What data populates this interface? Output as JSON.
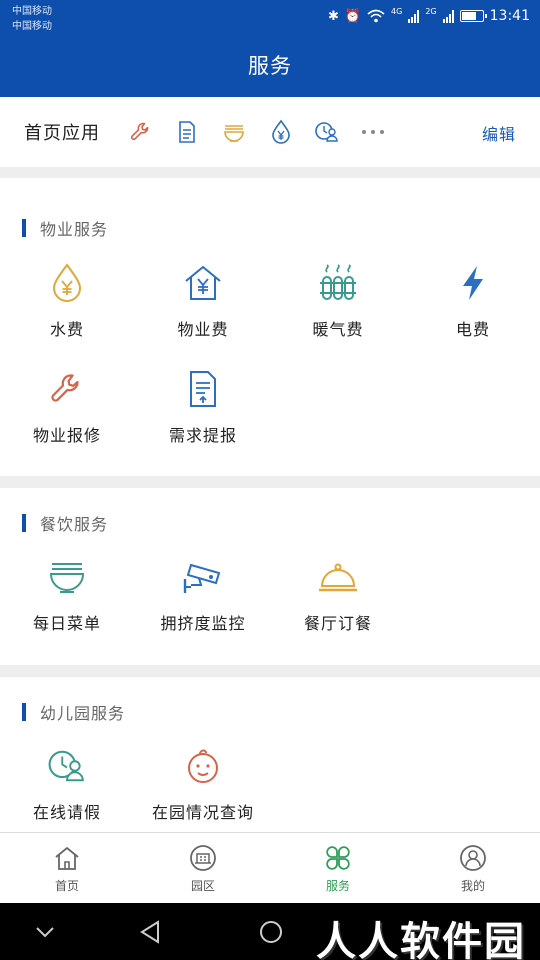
{
  "status_bar": {
    "carrier_1": "中国移动",
    "carrier_2": "中国移动",
    "net_1": "4G",
    "net_2": "2G",
    "time": "13:41"
  },
  "header": {
    "title": "服务"
  },
  "quick_apps": {
    "label": "首页应用",
    "edit_label": "编辑",
    "icons": [
      "wrench-icon",
      "document-icon",
      "noodle-bowl-icon",
      "water-drop-yen-icon",
      "clock-person-icon",
      "more-dots-icon"
    ]
  },
  "sections": {
    "property": {
      "title": "物业服务",
      "items": [
        {
          "label": "水费",
          "icon": "water-drop-yen-icon"
        },
        {
          "label": "物业费",
          "icon": "house-yen-icon"
        },
        {
          "label": "暖气费",
          "icon": "radiator-icon"
        },
        {
          "label": "电费",
          "icon": "lightning-icon"
        },
        {
          "label": "物业报修",
          "icon": "wrench-icon"
        },
        {
          "label": "需求提报",
          "icon": "document-upload-icon"
        }
      ]
    },
    "dining": {
      "title": "餐饮服务",
      "items": [
        {
          "label": "每日菜单",
          "icon": "noodle-bowl-icon"
        },
        {
          "label": "拥挤度监控",
          "icon": "security-camera-icon"
        },
        {
          "label": "餐厅订餐",
          "icon": "cloche-icon"
        }
      ]
    },
    "kindergarten": {
      "title": "幼儿园服务",
      "items": [
        {
          "label": "在线请假",
          "icon": "clock-person-icon"
        },
        {
          "label": "在园情况查询",
          "icon": "baby-face-icon"
        }
      ]
    }
  },
  "tabbar": {
    "tabs": [
      {
        "label": "首页",
        "icon": "home-icon"
      },
      {
        "label": "园区",
        "icon": "building-icon"
      },
      {
        "label": "服务",
        "icon": "clover-grid-icon",
        "active": true
      },
      {
        "label": "我的",
        "icon": "user-circle-icon"
      }
    ]
  },
  "navbar": {
    "watermark": "人人软件园"
  },
  "colors": {
    "primary": "#0e4fae",
    "active_tab": "#2f9d57",
    "orange": "#e2a63a",
    "red": "#d9634a",
    "teal": "#3a9b8c",
    "blue": "#2a6fc0"
  }
}
